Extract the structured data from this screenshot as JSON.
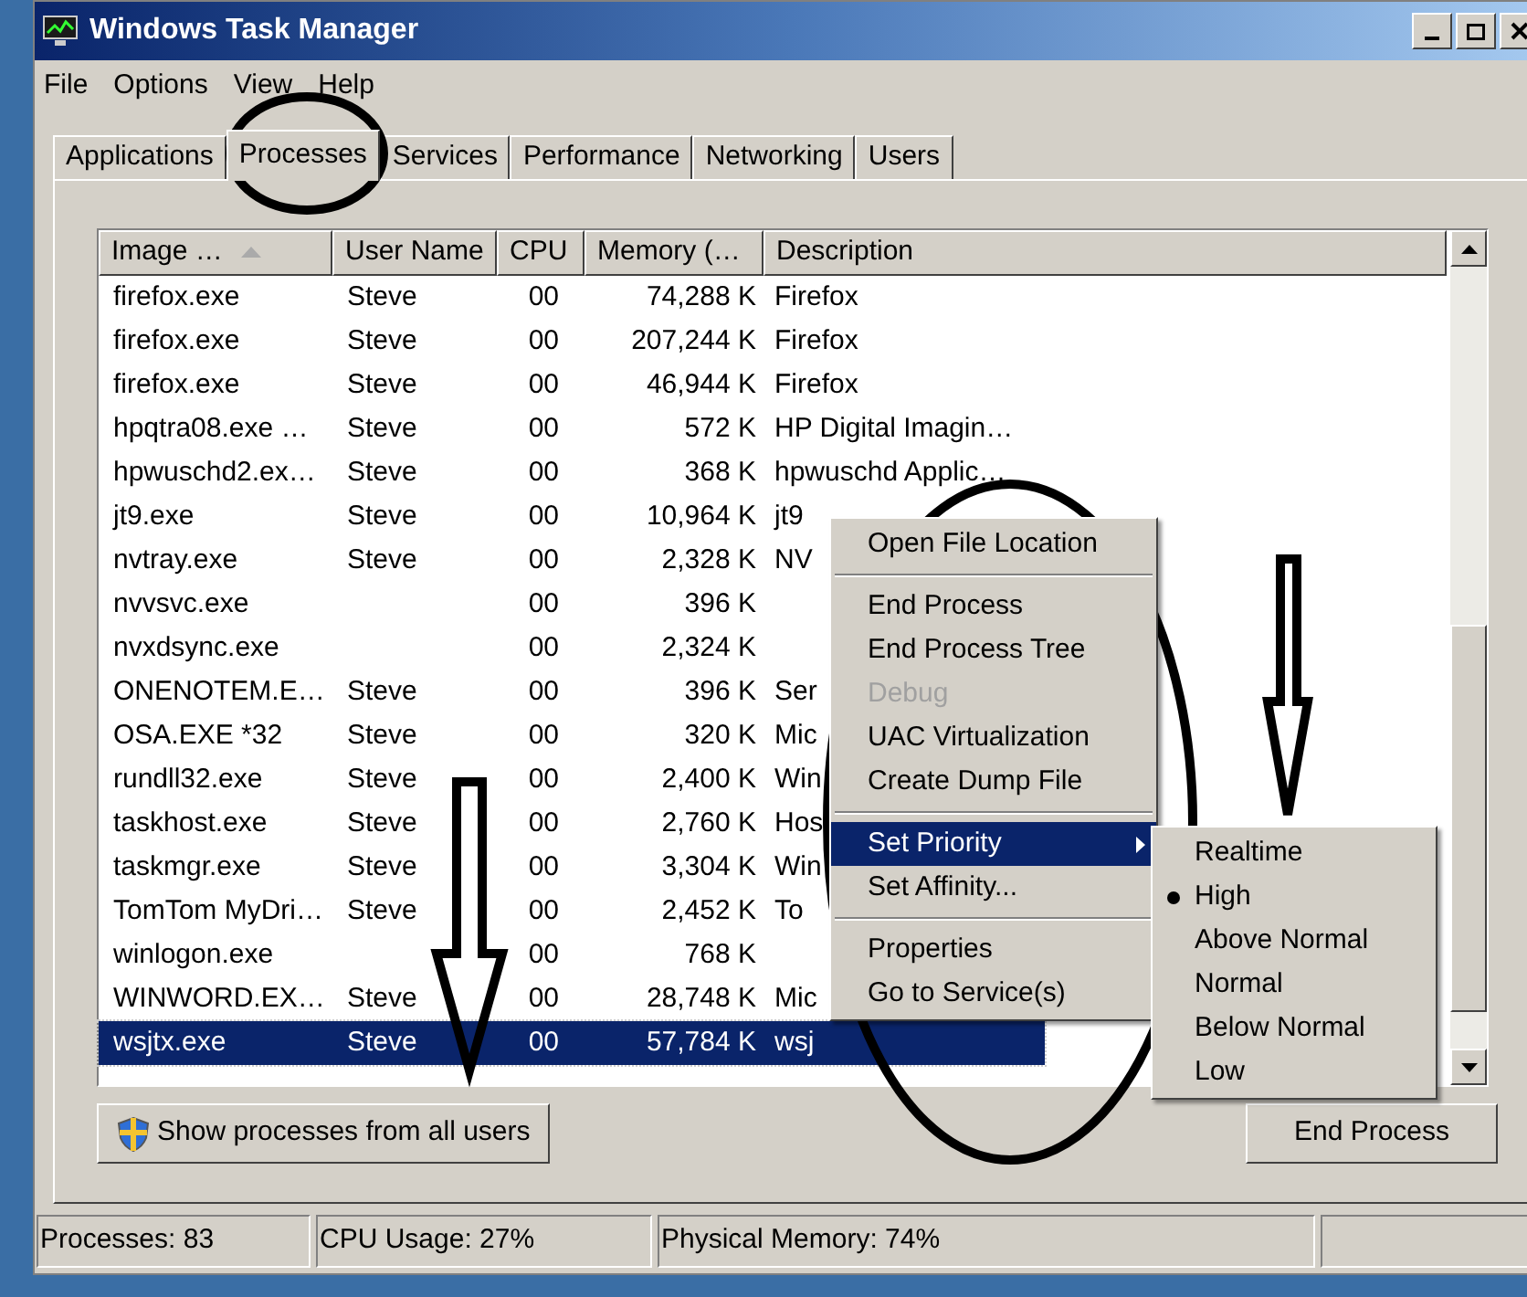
{
  "window": {
    "title": "Windows Task Manager"
  },
  "menu_bar": [
    "File",
    "Options",
    "View",
    "Help"
  ],
  "tabs": [
    {
      "label": "Applications",
      "selected": false
    },
    {
      "label": "Processes",
      "selected": true
    },
    {
      "label": "Services",
      "selected": false
    },
    {
      "label": "Performance",
      "selected": false
    },
    {
      "label": "Networking",
      "selected": false
    },
    {
      "label": "Users",
      "selected": false
    }
  ],
  "table": {
    "columns": [
      "Image …",
      "User Name",
      "CPU",
      "Memory (…",
      "Description"
    ],
    "rows": [
      {
        "image": "firefox.exe",
        "user": "Steve",
        "cpu": "00",
        "memory": "74,288 K",
        "description": "Firefox",
        "selected": false
      },
      {
        "image": "firefox.exe",
        "user": "Steve",
        "cpu": "00",
        "memory": "207,244 K",
        "description": "Firefox",
        "selected": false
      },
      {
        "image": "firefox.exe",
        "user": "Steve",
        "cpu": "00",
        "memory": "46,944 K",
        "description": "Firefox",
        "selected": false
      },
      {
        "image": "hpqtra08.exe …",
        "user": "Steve",
        "cpu": "00",
        "memory": "572 K",
        "description": "HP Digital Imagin…",
        "selected": false
      },
      {
        "image": "hpwuschd2.ex…",
        "user": "Steve",
        "cpu": "00",
        "memory": "368 K",
        "description": "hpwuschd Applic…",
        "selected": false
      },
      {
        "image": "jt9.exe",
        "user": "Steve",
        "cpu": "00",
        "memory": "10,964 K",
        "description": "jt9",
        "selected": false
      },
      {
        "image": "nvtray.exe",
        "user": "Steve",
        "cpu": "00",
        "memory": "2,328 K",
        "description": "NV",
        "selected": false
      },
      {
        "image": "nvvsvc.exe",
        "cpu": "00",
        "memory": "396 K",
        "selected": false
      },
      {
        "image": "nvxdsync.exe",
        "cpu": "00",
        "memory": "2,324 K",
        "selected": false
      },
      {
        "image": "ONENOTEM.E…",
        "user": "Steve",
        "cpu": "00",
        "memory": "396 K",
        "description": "Ser",
        "selected": false
      },
      {
        "image": "OSA.EXE *32",
        "user": "Steve",
        "cpu": "00",
        "memory": "320 K",
        "description": "Mic",
        "selected": false
      },
      {
        "image": "rundll32.exe",
        "user": "Steve",
        "cpu": "00",
        "memory": "2,400 K",
        "description": "Win",
        "selected": false
      },
      {
        "image": "taskhost.exe",
        "user": "Steve",
        "cpu": "00",
        "memory": "2,760 K",
        "description": "Hos",
        "selected": false
      },
      {
        "image": "taskmgr.exe",
        "user": "Steve",
        "cpu": "00",
        "memory": "3,304 K",
        "description": "Win",
        "selected": false
      },
      {
        "image": "TomTom MyDri…",
        "user": "Steve",
        "cpu": "00",
        "memory": "2,452 K",
        "description": "To",
        "selected": false
      },
      {
        "image": "winlogon.exe",
        "cpu": "00",
        "memory": "768 K",
        "selected": false
      },
      {
        "image": "WINWORD.EX…",
        "user": "Steve",
        "cpu": "00",
        "memory": "28,748 K",
        "description": "Mic",
        "selected": false
      },
      {
        "image": "wsjtx.exe",
        "user": "Steve",
        "cpu": "00",
        "memory": "57,784 K",
        "description": "wsj",
        "selected": true
      }
    ]
  },
  "context_menu": [
    [
      {
        "label": "Open File Location",
        "disabled": false,
        "selected": false
      }
    ],
    [
      {
        "label": "End Process",
        "disabled": false,
        "selected": false
      },
      {
        "label": "End Process Tree",
        "disabled": false,
        "selected": false
      },
      {
        "label": "Debug",
        "disabled": true,
        "selected": false
      },
      {
        "label": "UAC Virtualization",
        "disabled": false,
        "selected": false
      },
      {
        "label": "Create Dump File",
        "disabled": false,
        "selected": false
      }
    ],
    [
      {
        "label": "Set Priority",
        "disabled": false,
        "selected": true,
        "submenu": true
      },
      {
        "label": "Set Affinity...",
        "disabled": false,
        "selected": false
      }
    ],
    [
      {
        "label": "Properties",
        "disabled": false,
        "selected": false
      },
      {
        "label": "Go to Service(s)",
        "disabled": false,
        "selected": false
      }
    ]
  ],
  "priority_submenu": [
    {
      "label": "Realtime",
      "selected": false
    },
    {
      "label": "High",
      "selected": true
    },
    {
      "label": "Above Normal",
      "selected": false
    },
    {
      "label": "Normal",
      "selected": false
    },
    {
      "label": "Below Normal",
      "selected": false
    },
    {
      "label": "Low",
      "selected": false
    }
  ],
  "buttons": {
    "show_all": "Show processes from all users",
    "end_process": "End Process"
  },
  "status_bar": [
    "Processes: 83",
    "CPU Usage: 27%",
    "Physical Memory: 74%"
  ]
}
